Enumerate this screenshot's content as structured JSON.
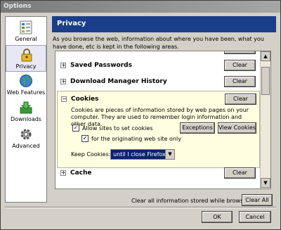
{
  "window": {
    "title": "Options"
  },
  "sidebar": {
    "items": [
      {
        "label": "General",
        "icon": "general-icon"
      },
      {
        "label": "Privacy",
        "icon": "lock-icon",
        "selected": true
      },
      {
        "label": "Web Features",
        "icon": "globe-icon"
      },
      {
        "label": "Downloads",
        "icon": "downloads-icon"
      },
      {
        "label": "Advanced",
        "icon": "gear-icon"
      }
    ]
  },
  "header": {
    "title": "Privacy"
  },
  "description": "As you browse the web, information about where you have been, what you have done, etc is kept in the following areas.",
  "sections": {
    "passwords": {
      "label": "Saved Passwords",
      "button": "Clear"
    },
    "download_history": {
      "label": "Download Manager History",
      "button": "Clear"
    },
    "cookies": {
      "label": "Cookies",
      "button": "Clear",
      "description": "Cookies are pieces of information stored by web pages on your computer. They are used to remember login information and other data.",
      "allow_label": "Allow sites to set cookies",
      "allow_checked": true,
      "origin_label": "for the originating web site only",
      "origin_checked": true,
      "exceptions_button": "Exceptions",
      "view_button": "View Cookies",
      "keep_label": "Keep Cookies:",
      "keep_value": "until I close Firefox"
    },
    "cache": {
      "label": "Cache",
      "button": "Clear"
    }
  },
  "footer": {
    "clear_all_text": "Clear all information stored while browsing:",
    "clear_all_button": "Clear All",
    "ok_button": "OK",
    "cancel_button": "Cancel"
  },
  "colors": {
    "header_bg": "#1b3e8a",
    "highlight_bg": "#fffee0",
    "selection": "#0a246a"
  }
}
